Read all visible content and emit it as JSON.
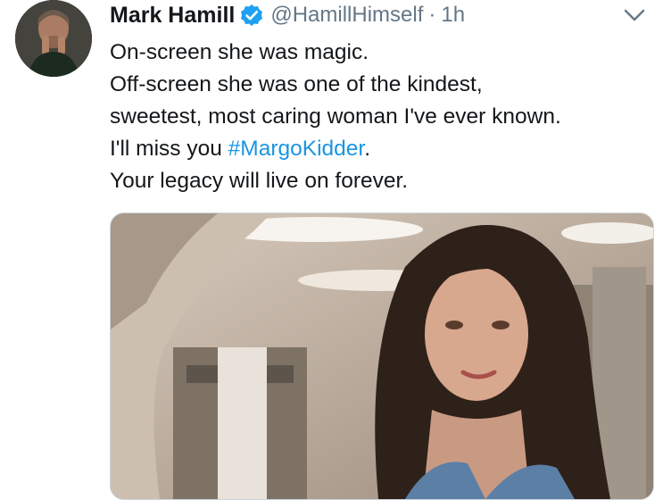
{
  "tweet": {
    "author_name": "Mark Hamill",
    "handle": "@HamillHimself",
    "separator": "·",
    "time": "1h",
    "lines": {
      "l1": "On-screen she was magic.",
      "l2": "Off-screen she was one of the kindest,",
      "l3": "sweetest, most caring woman I've ever known.",
      "l4_prefix": "I'll miss you ",
      "l4_hashtag": "#MargoKidder",
      "l4_suffix": ".",
      "l5": "Your legacy will live on forever."
    }
  },
  "icons": {
    "verified": "verified-badge-icon",
    "menu": "chevron-down-icon"
  },
  "colors": {
    "text": "#14171a",
    "muted": "#657786",
    "link": "#1b95e0",
    "verified": "#1da1f2"
  }
}
